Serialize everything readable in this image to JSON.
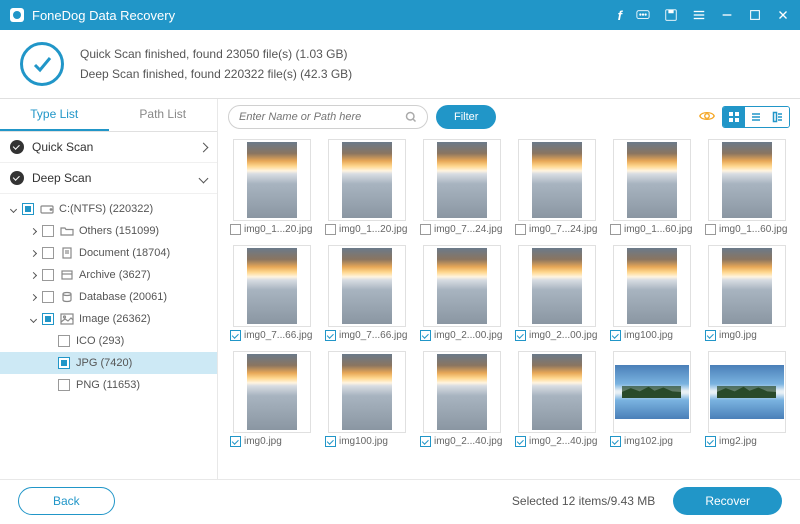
{
  "app": {
    "title": "FoneDog Data Recovery"
  },
  "status": {
    "line1": "Quick Scan finished, found 23050 file(s) (1.03 GB)",
    "line2": "Deep Scan finished, found 220322 file(s) (42.3 GB)"
  },
  "sidebar": {
    "tabs": {
      "type_list": "Type List",
      "path_list": "Path List"
    },
    "scans": {
      "quick": "Quick Scan",
      "deep": "Deep Scan"
    },
    "tree": {
      "drive": "C:(NTFS) (220322)",
      "others": "Others (151099)",
      "document": "Document (18704)",
      "archive": "Archive (3627)",
      "database": "Database (20061)",
      "image": "Image (26362)",
      "ico": "ICO (293)",
      "jpg": "JPG (7420)",
      "png": "PNG (11653)"
    }
  },
  "toolbar": {
    "search_placeholder": "Enter Name or Path here",
    "filter": "Filter"
  },
  "files": [
    {
      "name": "img0_1...20.jpg",
      "checked": false,
      "type": "sunset"
    },
    {
      "name": "img0_1...20.jpg",
      "checked": false,
      "type": "sunset"
    },
    {
      "name": "img0_7...24.jpg",
      "checked": false,
      "type": "sunset"
    },
    {
      "name": "img0_7...24.jpg",
      "checked": false,
      "type": "sunset"
    },
    {
      "name": "img0_1...60.jpg",
      "checked": false,
      "type": "sunset"
    },
    {
      "name": "img0_1...60.jpg",
      "checked": false,
      "type": "sunset"
    },
    {
      "name": "img0_7...66.jpg",
      "checked": true,
      "type": "sunset"
    },
    {
      "name": "img0_7...66.jpg",
      "checked": true,
      "type": "sunset"
    },
    {
      "name": "img0_2...00.jpg",
      "checked": true,
      "type": "sunset"
    },
    {
      "name": "img0_2...00.jpg",
      "checked": true,
      "type": "sunset"
    },
    {
      "name": "img100.jpg",
      "checked": true,
      "type": "sunset"
    },
    {
      "name": "img0.jpg",
      "checked": true,
      "type": "sunset"
    },
    {
      "name": "img0.jpg",
      "checked": true,
      "type": "sunset"
    },
    {
      "name": "img100.jpg",
      "checked": true,
      "type": "sunset"
    },
    {
      "name": "img0_2...40.jpg",
      "checked": true,
      "type": "sunset"
    },
    {
      "name": "img0_2...40.jpg",
      "checked": true,
      "type": "sunset"
    },
    {
      "name": "img102.jpg",
      "checked": true,
      "type": "island"
    },
    {
      "name": "img2.jpg",
      "checked": true,
      "type": "island"
    }
  ],
  "footer": {
    "back": "Back",
    "status": "Selected 12 items/9.43 MB",
    "recover": "Recover"
  }
}
